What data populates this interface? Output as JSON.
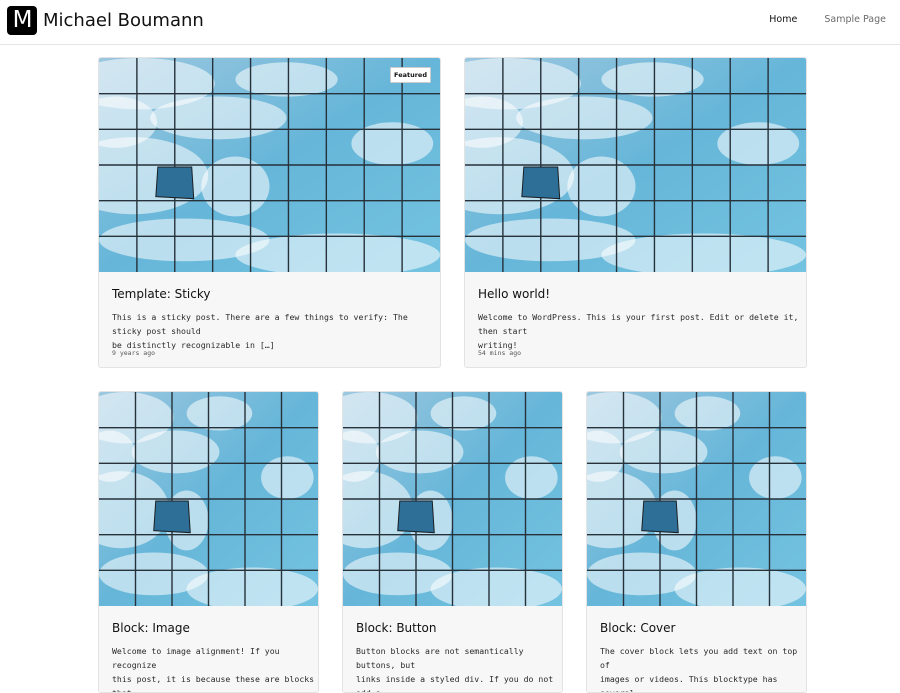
{
  "site": {
    "logo_letter": "M",
    "title": "Michael Boumann"
  },
  "nav": {
    "items": [
      {
        "label": "Home"
      },
      {
        "label": "Sample Page"
      }
    ]
  },
  "posts": [
    {
      "title": "Template: Sticky",
      "excerpt_lines": [
        "This is a sticky post. There are a few things to verify: The sticky post should",
        "be distinctly recognizable in […]"
      ],
      "date": "9 years ago",
      "badge": "Featured"
    },
    {
      "title": "Hello world!",
      "excerpt_lines": [
        "Welcome to WordPress. This is your first post. Edit or delete it, then start",
        "writing!"
      ],
      "date": "54 mins ago"
    },
    {
      "title": "Block: Image",
      "excerpt_lines": [
        "Welcome to image alignment! If you recognize",
        "this post, it is because these are blocks that"
      ]
    },
    {
      "title": "Block: Button",
      "excerpt_lines": [
        "Button blocks are not semantically buttons, but",
        "links inside a styled div.  If you do not add a"
      ]
    },
    {
      "title": "Block: Cover",
      "excerpt_lines": [
        "The cover block lets you add text on top of",
        "images or videos. This blocktype has several"
      ]
    }
  ]
}
